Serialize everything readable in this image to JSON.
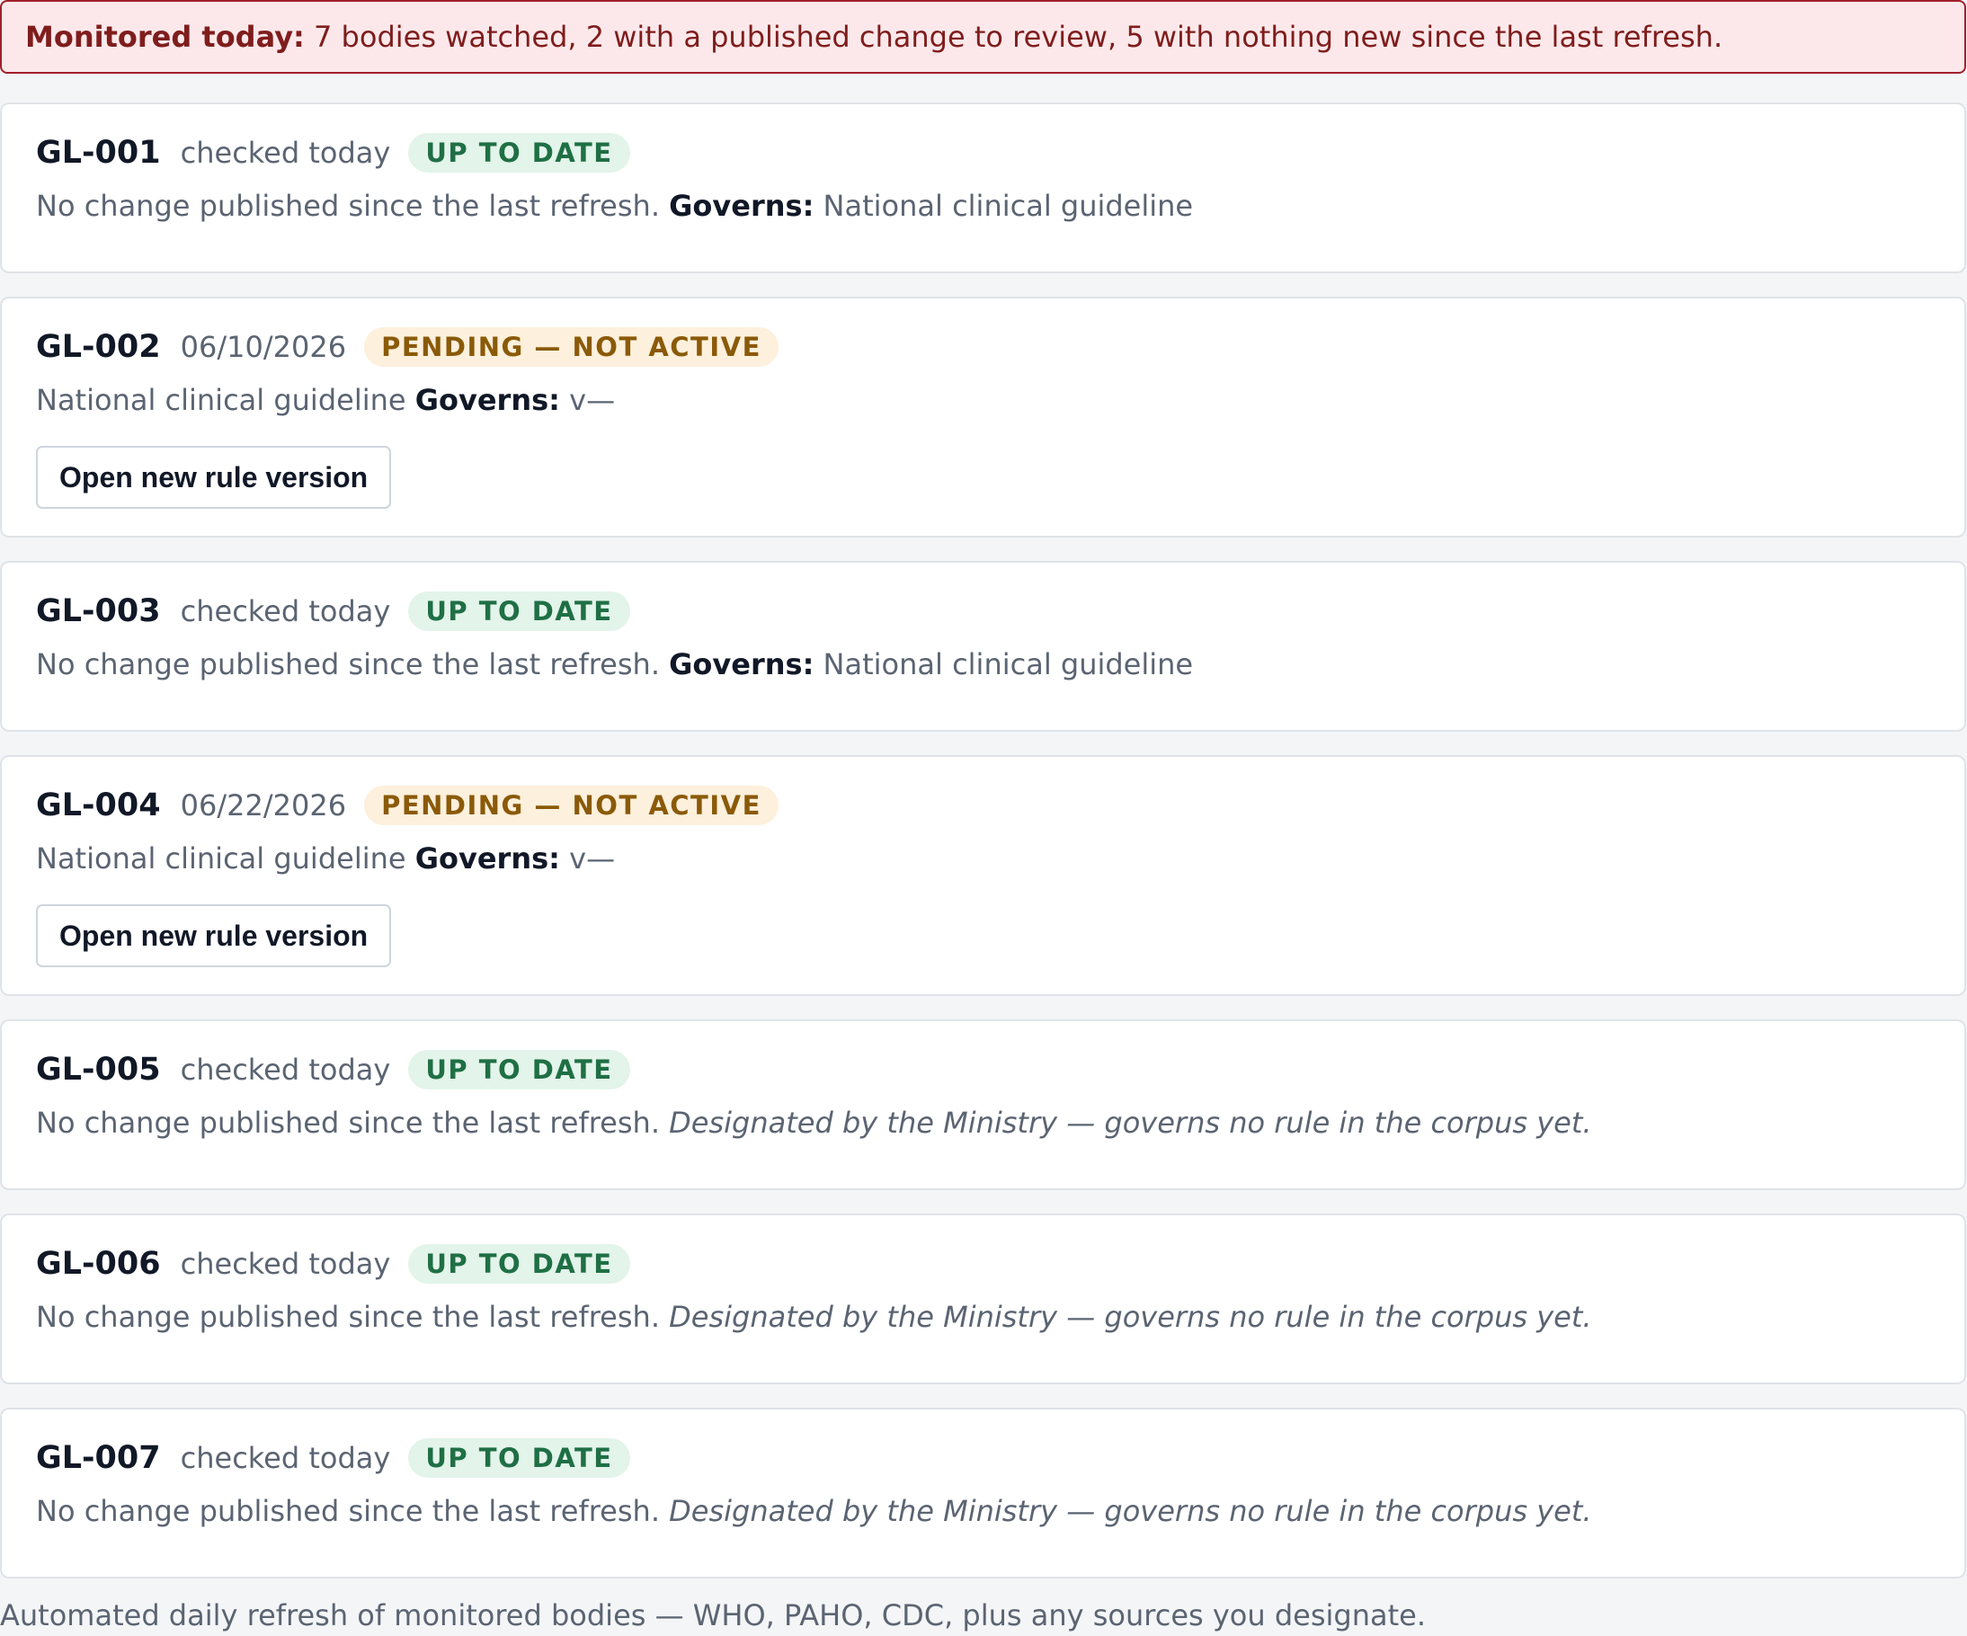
{
  "banner": {
    "lead": "Monitored today:",
    "text": " 7 bodies watched, 2 with a published change to review, 5 with nothing new since the last refresh."
  },
  "cards": [
    {
      "code": "GL-001",
      "checked": "checked today",
      "status": "UP TO DATE",
      "kind": "up",
      "desc_prefix": "No change published since the last refresh.",
      "governs_label": "Governs:",
      "governs_value": "National clinical guideline"
    },
    {
      "code": "GL-002",
      "checked": "06/10/2026",
      "status": "PENDING — NOT ACTIVE",
      "kind": "pending",
      "desc_prefix": "National clinical guideline",
      "governs_label": "Governs:",
      "governs_value": "v—",
      "button_label": "Open new rule version"
    },
    {
      "code": "GL-003",
      "checked": "checked today",
      "status": "UP TO DATE",
      "kind": "up",
      "desc_prefix": "No change published since the last refresh.",
      "governs_label": "Governs:",
      "governs_value": "National clinical guideline"
    },
    {
      "code": "GL-004",
      "checked": "06/22/2026",
      "status": "PENDING — NOT ACTIVE",
      "kind": "pending",
      "desc_prefix": "National clinical guideline",
      "governs_label": "Governs:",
      "governs_value": "v—",
      "button_label": "Open new rule version"
    },
    {
      "code": "GL-005",
      "checked": "checked today",
      "status": "UP TO DATE",
      "kind": "up",
      "desc_prefix": "No change published since the last refresh.",
      "designated_note": "Designated by the Ministry — governs no rule in the corpus yet."
    },
    {
      "code": "GL-006",
      "checked": "checked today",
      "status": "UP TO DATE",
      "kind": "up",
      "desc_prefix": "No change published since the last refresh.",
      "designated_note": "Designated by the Ministry — governs no rule in the corpus yet."
    },
    {
      "code": "GL-007",
      "checked": "checked today",
      "status": "UP TO DATE",
      "kind": "up",
      "desc_prefix": "No change published since the last refresh.",
      "designated_note": "Designated by the Ministry — governs no rule in the corpus yet."
    }
  ],
  "footer": {
    "text": "Automated daily refresh of monitored bodies — WHO, PAHO, CDC, plus any sources you designate."
  },
  "colors": {
    "banner_bg": "#fce8ea",
    "banner_border": "#a11f2c",
    "ok_badge_bg": "#e3f4ea",
    "ok_badge_text": "#1f6f45",
    "warn_badge_bg": "#fdf0dc",
    "warn_badge_text": "#8a5a08"
  }
}
